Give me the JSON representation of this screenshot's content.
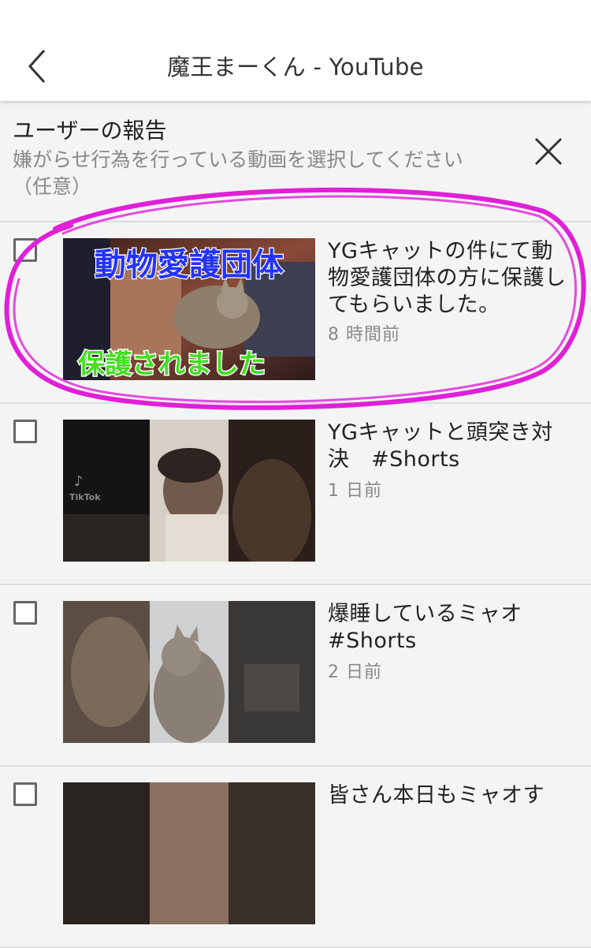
{
  "appbar": {
    "title": "魔王まーくん - YouTube",
    "back_icon": "chevron-left-icon"
  },
  "dialog": {
    "title": "ユーザーの報告",
    "subtitle": "嫌がらせ行為を行っている動画を選択してください（任意）",
    "close_icon": "close-icon"
  },
  "videos": [
    {
      "title": "YGキャットの件にて動物愛護団体の方に保護してもらいました。",
      "time": "8 時間前",
      "checked": false,
      "thumb_top_text": "動物愛護団体",
      "thumb_bottom_text": "保護されました"
    },
    {
      "title": "YGキャットと頭突き対決　#Shorts",
      "time": "1 日前",
      "checked": false,
      "thumb_watermark": "TikTok"
    },
    {
      "title": "爆睡しているミャオ #Shorts",
      "time": "2 日前",
      "checked": false
    },
    {
      "title": "皆さん本日もミャオす",
      "time": "",
      "checked": false
    }
  ],
  "colors": {
    "annotation": "#e020d8",
    "thumb_caption_top": "#2233ff",
    "thumb_caption_bottom": "#44dd22"
  }
}
